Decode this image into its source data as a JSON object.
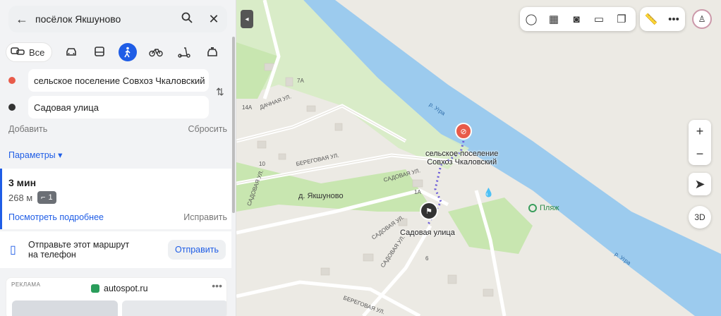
{
  "search": {
    "query": "посёлок Якшуново"
  },
  "modes": {
    "all_label": "Все"
  },
  "route_points": {
    "from": "сельское поселение Совхоз Чкаловский",
    "to": "Садовая улица"
  },
  "actions": {
    "add": "Добавить",
    "reset": "Сбросить",
    "params": "Параметры ▾"
  },
  "route": {
    "time": "3 мин",
    "distance": "268 м",
    "stairs": "1",
    "details": "Посмотреть подробнее",
    "fix": "Исправить"
  },
  "send": {
    "text": "Отправьте этот маршрут на телефон",
    "button": "Отправить"
  },
  "ad": {
    "tag": "РЕКЛАМА",
    "brand": "autospot.ru"
  },
  "map": {
    "labels": {
      "village": "д. Якшуново",
      "dest": "Садовая улица",
      "origin_line1": "сельское поселение",
      "origin_line2": "Совхоз Чкаловский",
      "beach": "Пляж",
      "river1": "р. Угра",
      "river2": "р. Угра",
      "street_dachnaya": "ДАЧНАЯ УЛ.",
      "street_beregovaya": "БЕРЕГОВАЯ УЛ.",
      "street_beregovaya2": "БЕРЕГОВАЯ УЛ.",
      "street_sadovaya": "САДОВАЯ УЛ.",
      "street_sadovaya2": "САДОВАЯ УЛ.",
      "street_sadovaya3": "САДОВАЯ УЛ.",
      "street_sadovaya4": "САДОВАЯ УЛ.",
      "num_7a": "7А",
      "num_14a": "14А",
      "num_10": "10",
      "num_1a": "1А",
      "num_6": "6"
    },
    "controls": {
      "three_d": "3D"
    }
  },
  "colors": {
    "accent": "#1f5de6",
    "origin": "#e85b4a",
    "river": "#9ccbee",
    "park": "#c8e6b0"
  }
}
